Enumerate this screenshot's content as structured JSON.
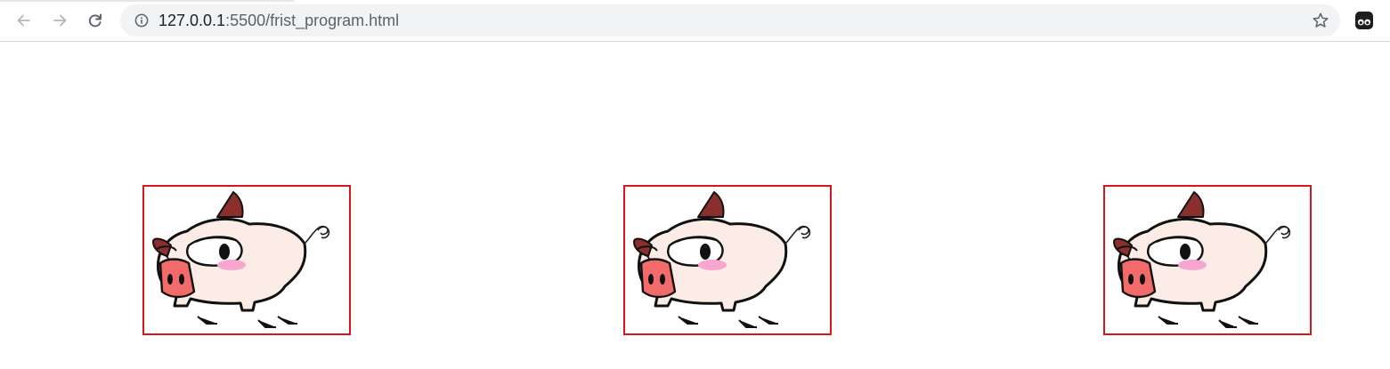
{
  "browser": {
    "url_host": "127.0.0.1",
    "url_rest": ":5500/frist_program.html",
    "icons": {
      "back": "arrow-left-icon",
      "forward": "arrow-right-icon",
      "reload": "reload-icon",
      "site_info": "info-icon",
      "bookmark": "star-icon",
      "extension": "extension-icon"
    }
  },
  "page": {
    "images": [
      {
        "subject": "cartoon pig",
        "border_color": "#d9161c"
      },
      {
        "subject": "cartoon pig",
        "border_color": "#d9161c"
      },
      {
        "subject": "cartoon pig",
        "border_color": "#d9161c"
      }
    ]
  }
}
